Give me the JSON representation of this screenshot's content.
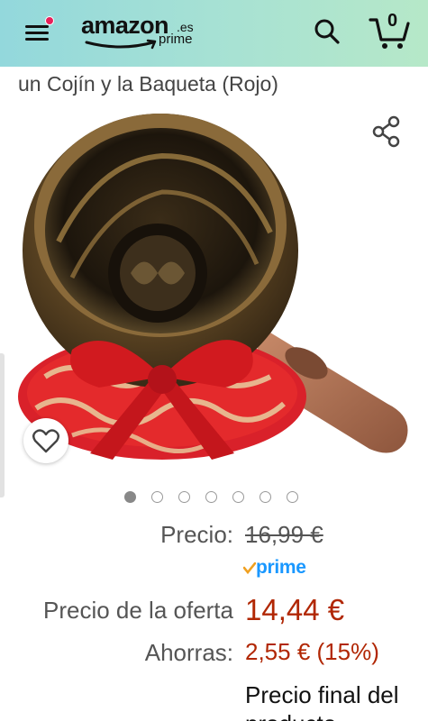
{
  "header": {
    "logo_word": "amazon",
    "logo_tld": ".es",
    "logo_sub": "prime",
    "cart_count": "0",
    "accent": "#e8205a"
  },
  "product": {
    "title_fragment": "un Cojín y la Baqueta (Rojo)",
    "image_count": 7,
    "active_image": 1
  },
  "pricing": {
    "list_label": "Precio:",
    "list_price": "16,99 €",
    "prime_label": "prime",
    "offer_label": "Precio de la oferta",
    "offer_price": "14,44 €",
    "savings_label": "Ahorras:",
    "savings_value": "2,55 € (15%)",
    "final_note": "Precio final del producto",
    "price_color": "#b12704",
    "prime_color": "#1a98ff"
  },
  "icons": {
    "menu": "hamburger-menu-icon",
    "search": "search-icon",
    "cart": "cart-icon",
    "share": "share-icon",
    "wishlist": "heart-icon"
  }
}
